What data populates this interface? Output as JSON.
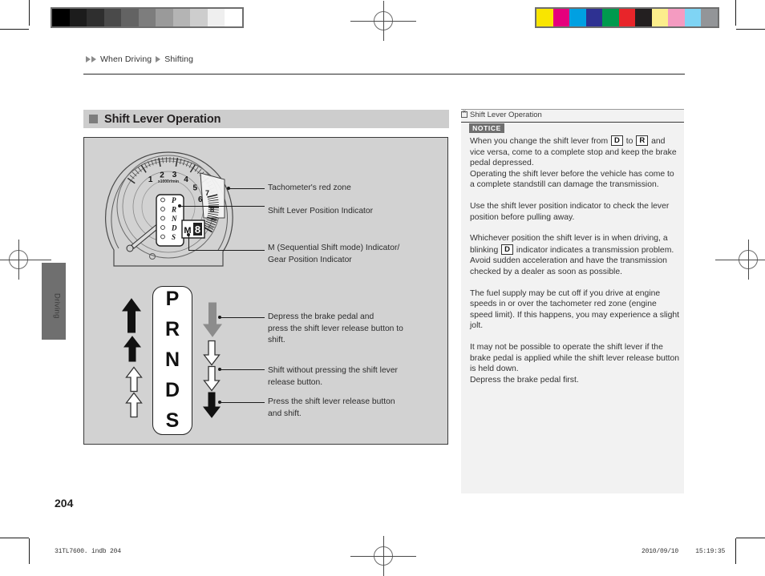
{
  "document": {
    "breadcrumb": {
      "level1": "When Driving",
      "level2": "Shifting"
    },
    "section_title": "Shift Lever Operation",
    "page_number": "204",
    "footer_left": "31TL7600. indb    204",
    "footer_date": "2010/09/10",
    "footer_time": "15:19:35",
    "side_tab": "Driving"
  },
  "calibration": {
    "gray_steps": [
      "#000000",
      "#1c1c1c",
      "#2f2f2f",
      "#4a4a4a",
      "#636363",
      "#7d7d7d",
      "#9a9a9a",
      "#b4b4b4",
      "#cdcdcd",
      "#efefef",
      "#ffffff"
    ],
    "color_steps": [
      "#f9e500",
      "#e5007d",
      "#00a0e2",
      "#2e3192",
      "#009a4e",
      "#e8252a",
      "#231f20",
      "#fcee8c",
      "#f49bc1",
      "#7fd4f4",
      "#939598"
    ]
  },
  "illustration": {
    "tachometer": {
      "scale_unit": "x1000r/min",
      "ticks": [
        "1",
        "2",
        "3",
        "4",
        "5",
        "6",
        "7",
        "8"
      ],
      "shift_positions": [
        "P",
        "R",
        "N",
        "D",
        "S"
      ],
      "m_indicator_label": "M",
      "gear_digit": "8"
    },
    "lever_letters": [
      "P",
      "R",
      "N",
      "D",
      "S"
    ],
    "callouts": [
      {
        "id": "tach-red-zone",
        "text": "Tachometer's red zone"
      },
      {
        "id": "shift-lever-position-indicator",
        "text": "Shift Lever Position Indicator"
      },
      {
        "id": "m-indicator",
        "line1": "M (Sequential Shift mode) Indicator/",
        "line2": "Gear Position Indicator"
      },
      {
        "id": "depress-brake",
        "line1": "Depress the brake pedal and",
        "line2": "press the shift lever release button to",
        "line3": "shift."
      },
      {
        "id": "shift-without",
        "line1": "Shift without pressing the shift lever",
        "line2": "release button."
      },
      {
        "id": "press-release",
        "line1": "Press the shift lever release button",
        "line2": "and shift."
      }
    ],
    "arrow_colors": {
      "black": "#111111",
      "gray": "#8c8c8c",
      "outline_fill": "#ffffff",
      "outline_stroke": "#333333"
    }
  },
  "notice_panel": {
    "header": "Shift Lever Operation",
    "badge": "NOTICE",
    "paragraphs": [
      {
        "type": "rich",
        "parts": [
          "When you change the shift lever from ",
          "D",
          " to ",
          "R",
          " and vice versa, come to a complete stop and keep the brake pedal depressed."
        ]
      },
      {
        "type": "text",
        "text": "Operating the shift lever before the vehicle has come to a complete standstill can damage the transmission."
      },
      {
        "type": "text",
        "text": "Use the shift lever position indicator to check the lever position before pulling away."
      },
      {
        "type": "rich",
        "parts": [
          "Whichever position the shift lever is in when driving, a blinking ",
          "D",
          " indicator indicates a transmission problem."
        ]
      },
      {
        "type": "text",
        "text": "Avoid sudden acceleration and have the transmission checked by a dealer as soon as possible."
      },
      {
        "type": "text",
        "text": "The fuel supply may be cut off if you drive at engine speeds in or over the tachometer red zone (engine speed limit). If this happens, you may experience a slight jolt."
      },
      {
        "type": "text",
        "text": "It may not be possible to operate the shift lever if the brake pedal is applied while the shift lever release button is held down."
      },
      {
        "type": "text",
        "text": "Depress the brake pedal first."
      }
    ],
    "keys": {
      "drive": "D",
      "reverse": "R"
    }
  }
}
